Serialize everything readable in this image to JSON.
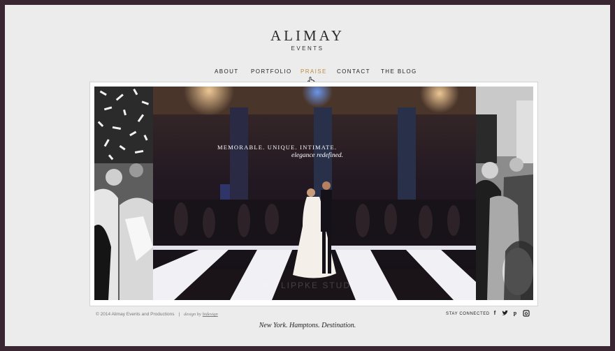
{
  "brand": {
    "name": "ALIMAY",
    "sub": "EVENTS"
  },
  "nav": [
    {
      "label": "ABOUT",
      "active": false
    },
    {
      "label": "PORTFOLIO",
      "active": false
    },
    {
      "label": "PRAISE",
      "active": true
    },
    {
      "label": "CONTACT",
      "active": false
    },
    {
      "label": "THE BLOG",
      "active": false
    }
  ],
  "hero": {
    "line1": "MEMORABLE. UNIQUE. INTIMATE.",
    "line2": "elegance redefined.",
    "watermark": "IRA LIPPKE STUDIOS"
  },
  "footer": {
    "copyright": "© 2014 Alimay Events and Productions",
    "separator": "|",
    "design_prefix": "design by",
    "design_link": "bidesign",
    "stay_connected": "STAY CONNECTED",
    "tagline": "New York. Hamptons. Destination."
  },
  "social": [
    "facebook-icon",
    "twitter-icon",
    "pinterest-icon",
    "instagram-icon"
  ],
  "colors": {
    "active_nav": "#c08a3e",
    "frame": "#3a2633",
    "page_bg": "#ececec"
  }
}
